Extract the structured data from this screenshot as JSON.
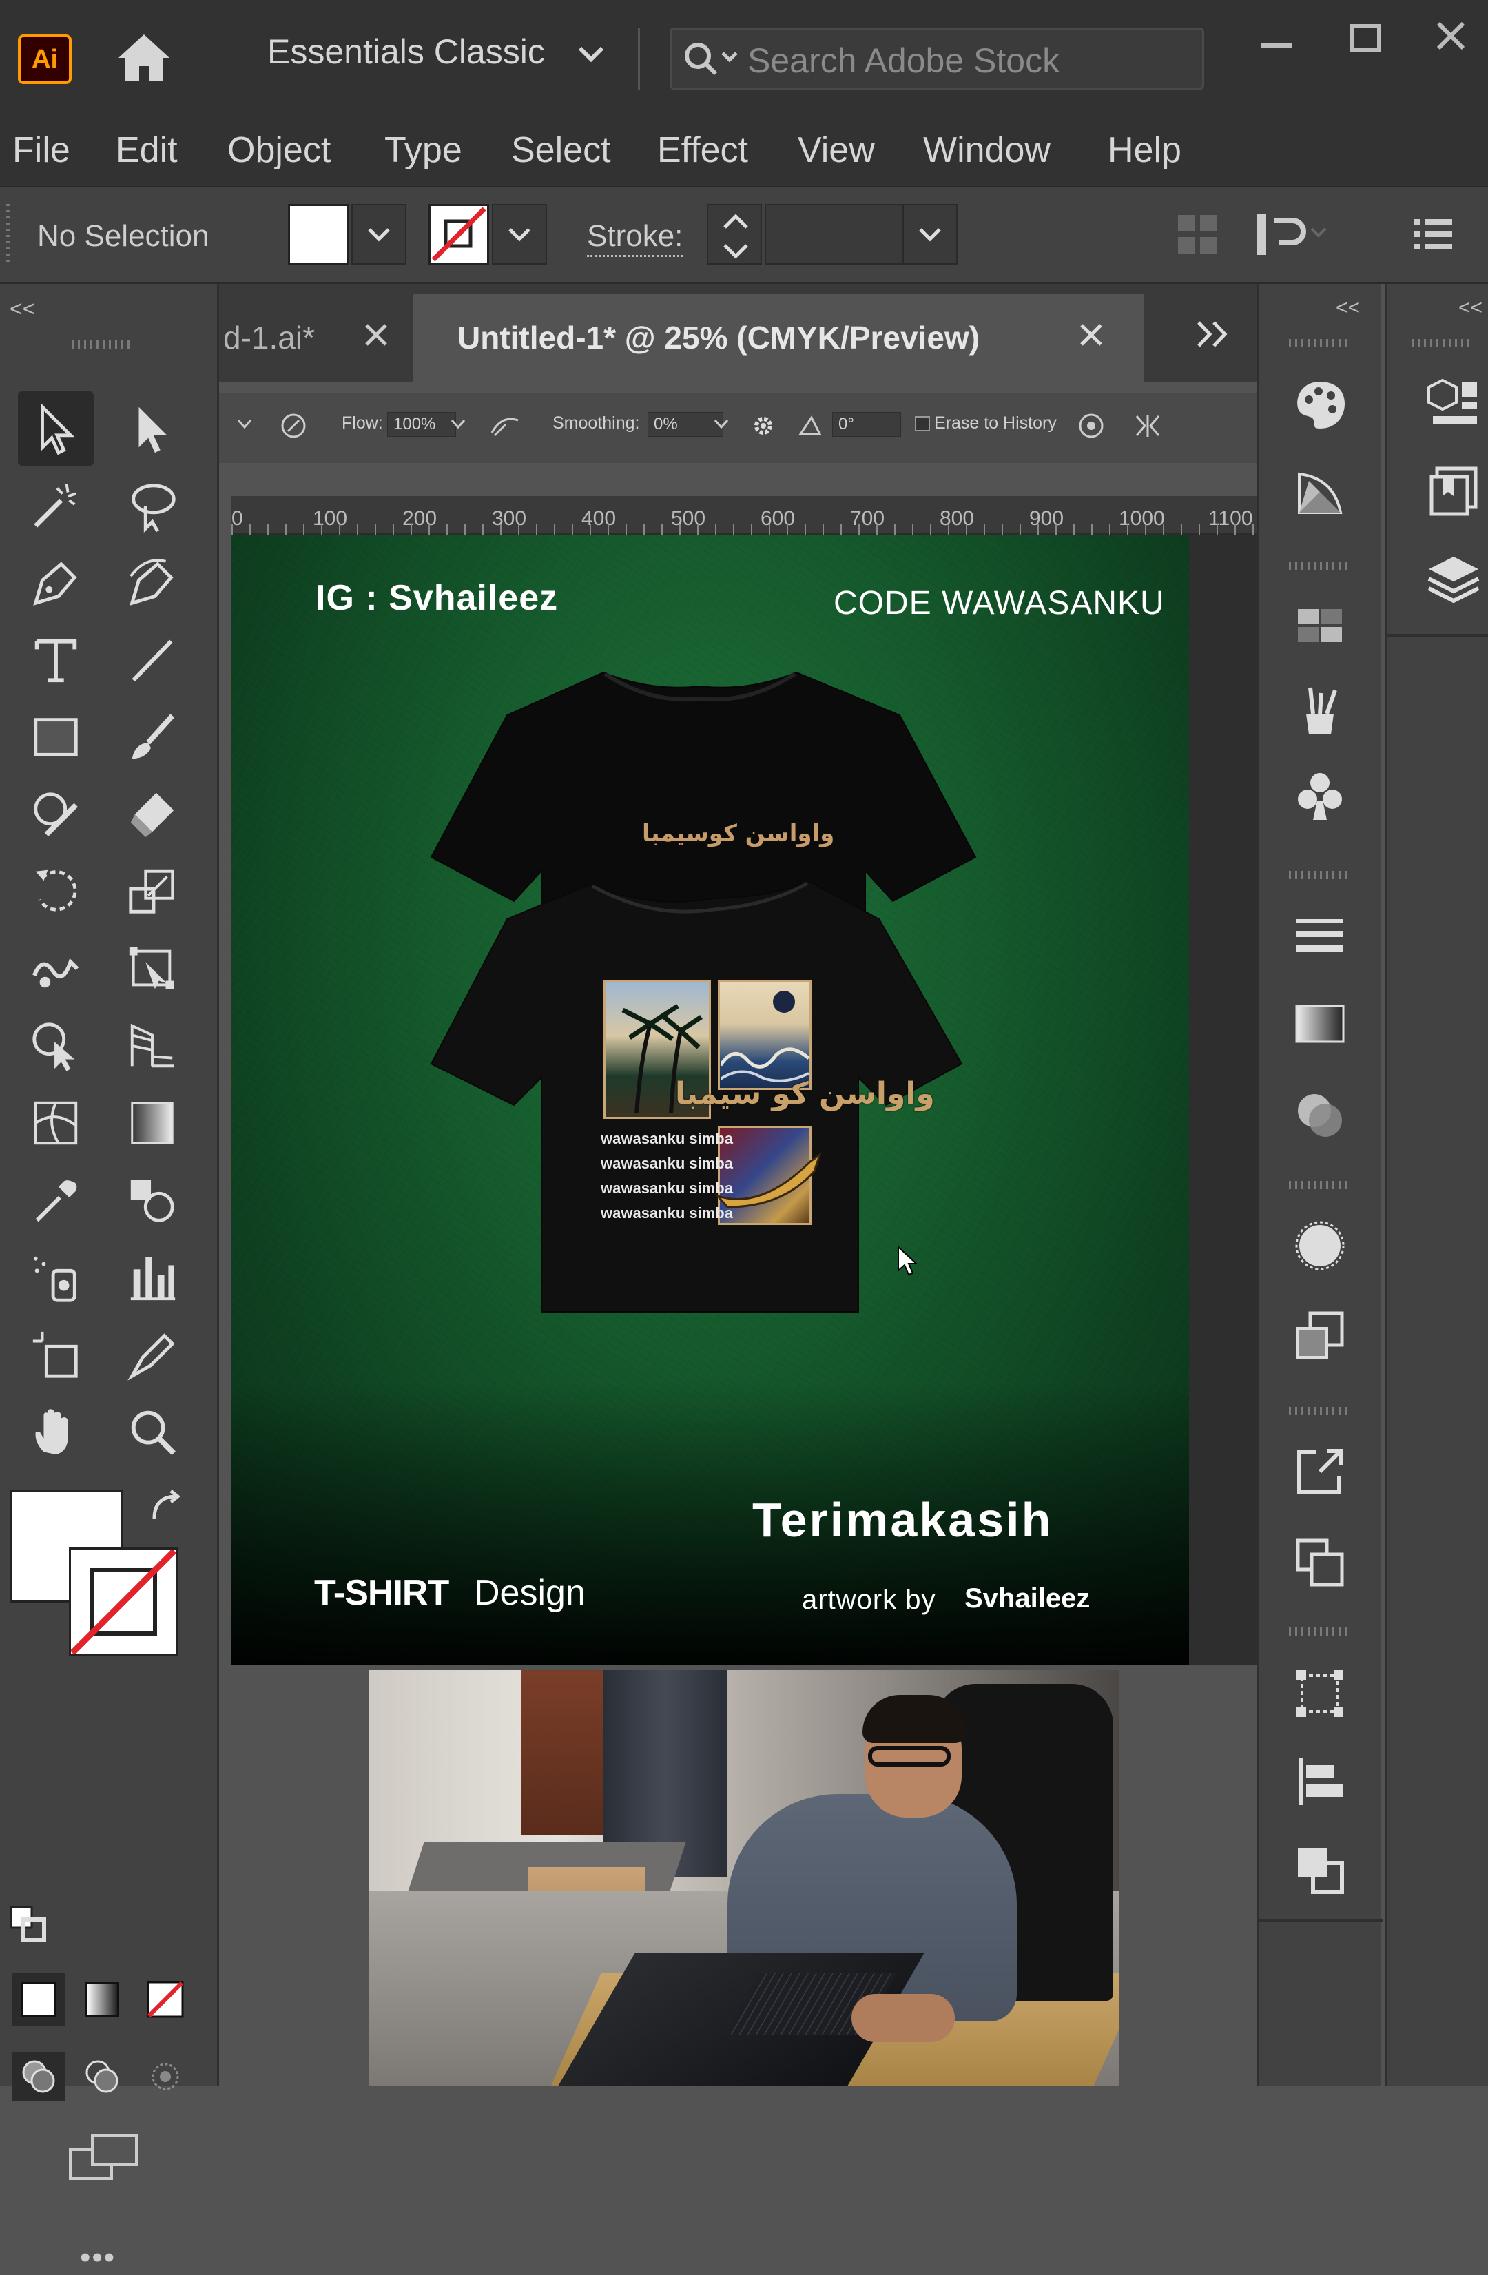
{
  "app": {
    "logo": "Ai",
    "workspace": "Essentials Classic",
    "search_placeholder": "Search Adobe Stock"
  },
  "menu": [
    "File",
    "Edit",
    "Object",
    "Type",
    "Select",
    "Effect",
    "View",
    "Window",
    "Help"
  ],
  "control": {
    "selection": "No Selection",
    "stroke_label": "Stroke:"
  },
  "tabs": {
    "inactive": "d-1.ai*",
    "active": "Untitled-1* @ 25% (CMYK/Preview)"
  },
  "eraser_options": {
    "flow_label": "Flow:",
    "flow_value": "100%",
    "smoothing_label": "Smoothing:",
    "smoothing_value": "0%",
    "angle_value": "0°",
    "erase_history": "Erase to History"
  },
  "ruler": [
    "0",
    "100",
    "200",
    "300",
    "400",
    "500",
    "600",
    "700",
    "800",
    "900",
    "1000",
    "1100"
  ],
  "artwork": {
    "ig": "IG : Svhaileez",
    "code": "CODE WAWASANKU",
    "arabic_top": "واواسن کوسیمبا",
    "arabic_print": "واواسن کو سیمبا",
    "print_lines": [
      "wawasanku simba",
      "wawasanku simba",
      "wawasanku simba",
      "wawasanku simba"
    ],
    "thanks": "Terimakasih",
    "tshirt_bold": "T-SHIRT",
    "tshirt_light": "Design",
    "artwork_by": "artwork by",
    "artist": "Svhaileez",
    "bg_color": "#155a2c"
  },
  "colors": {
    "accent": "#ff9a00",
    "fill": "#ffffff",
    "stroke_none": "#e0242a"
  },
  "more": "•••"
}
